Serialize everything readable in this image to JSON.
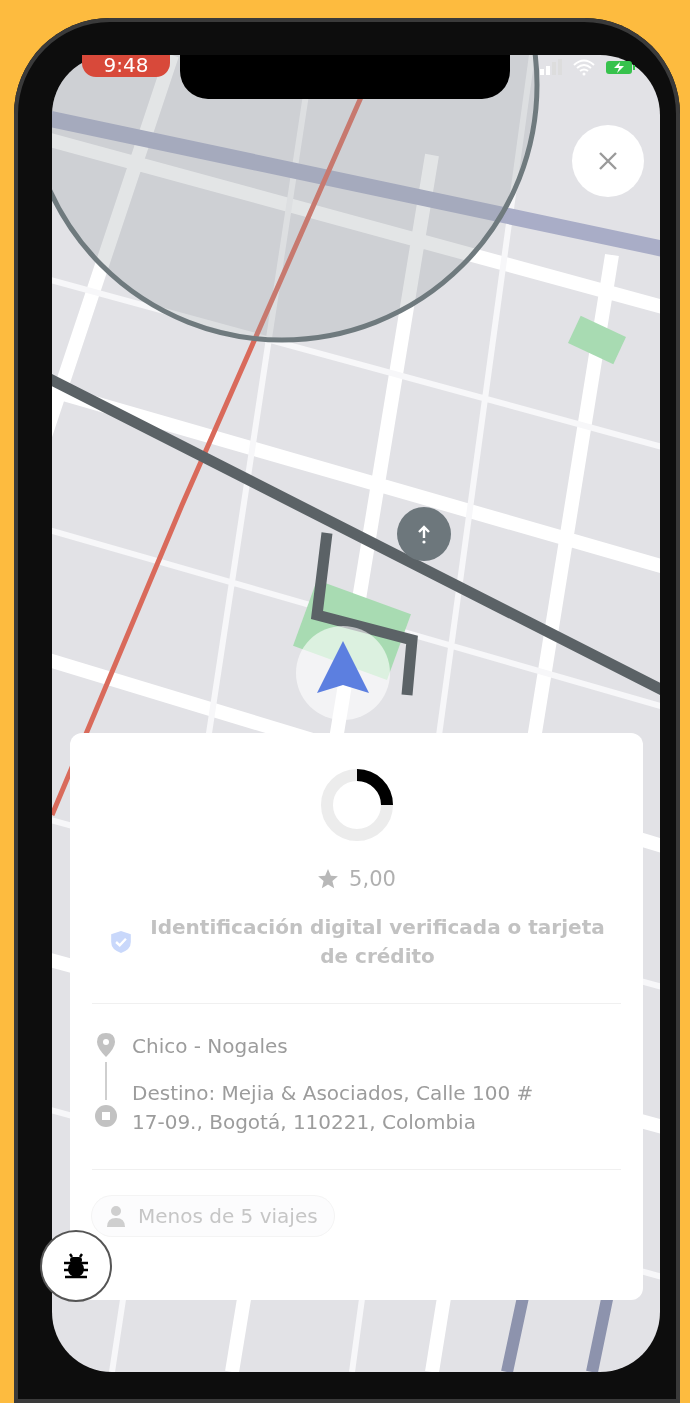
{
  "status_bar": {
    "time": "9:48"
  },
  "rider_card": {
    "progress": {
      "level": 0.25
    },
    "rating": "5,00",
    "verification": "Identificación digital verificada o tarjeta de crédito",
    "pickup": "Chico - Nogales",
    "destination": "Destino: Mejia & Asociados, Calle 100 # 17-09., Bogotá, 110221, Colombia",
    "badge": "Menos de 5 viajes"
  }
}
